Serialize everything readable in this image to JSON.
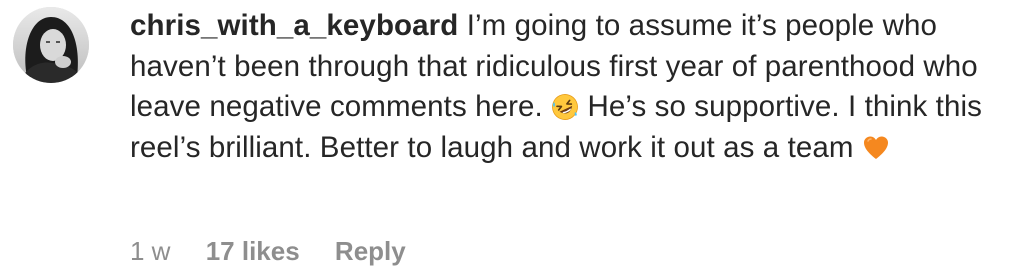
{
  "comment": {
    "username": "chris_with_a_keyboard",
    "text_part1": "I’m going to assume it’s people who haven’t been through that ridiculous first year of parenthood who leave negative comments here.",
    "emoji_1": "rolling-on-floor-laughing-emoji",
    "text_part2": "He’s so supportive. I think this reel’s brilliant. Better to laugh and work it out as a team",
    "emoji_2": "orange-heart-emoji"
  },
  "meta": {
    "time": "1 w",
    "likes": "17 likes",
    "reply": "Reply"
  },
  "colors": {
    "text": "#262626",
    "secondary": "#8e8e8e",
    "heart": "#F5881F"
  }
}
